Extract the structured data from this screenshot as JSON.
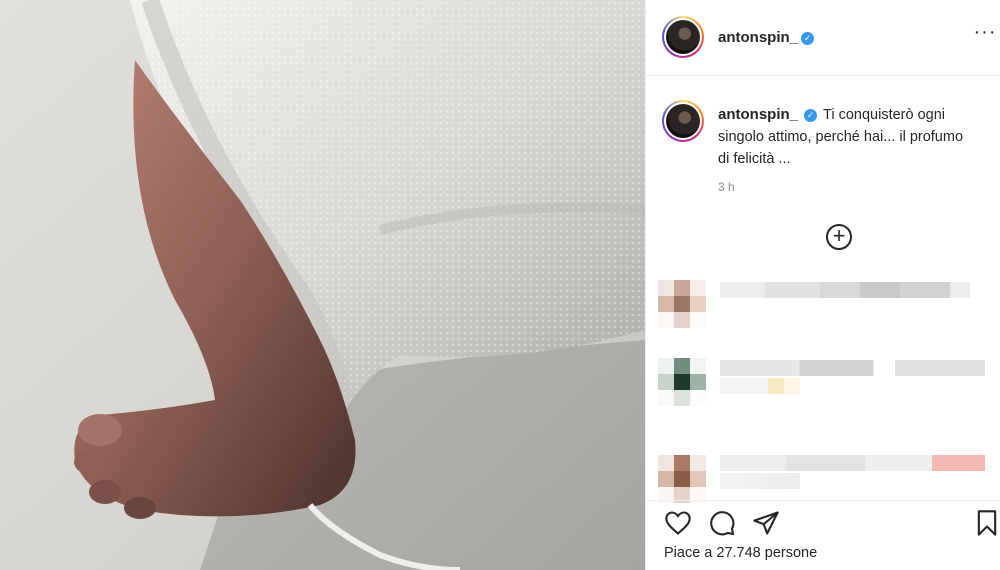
{
  "post": {
    "username": "antonspin_",
    "verified": true,
    "caption": "Ti conquisterò ogni singolo attimo, perché hai... il profumo di felicità ...",
    "timestamp": "3 h",
    "likes_text": "Piace a 27.748 persone"
  },
  "icons": {
    "more": "more-options-icon",
    "load_more": "plus-circle-icon",
    "like": "heart-icon",
    "comment": "comment-bubble-icon",
    "share": "paper-plane-icon",
    "save": "bookmark-icon",
    "verified": "verified-badge-icon"
  },
  "colors": {
    "verified_blue": "#3897f0",
    "muted_text": "#8e8e8e",
    "border": "#efefef"
  }
}
